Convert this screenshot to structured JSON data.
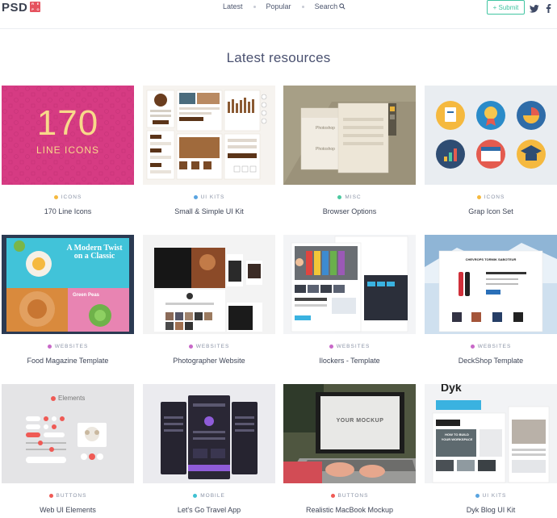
{
  "header": {
    "logo_text": "PSD",
    "logo_badge": [
      "R",
      "E",
      "P",
      "O"
    ],
    "nav": [
      {
        "label": "Latest"
      },
      {
        "label": "Popular"
      },
      {
        "label": "Search"
      }
    ],
    "submit_label": "+ Submit",
    "social_icons": [
      "twitter-icon",
      "facebook-icon"
    ]
  },
  "section_title": "Latest resources",
  "category_colors": {
    "ICONS": "#f5b93f",
    "UI KITS": "#5aa4e0",
    "MISC": "#4cc9a0",
    "WEBSITES": "#c868c8",
    "BUTTONS": "#ef5a55",
    "MOBILE": "#3fc1d2"
  },
  "cards": [
    {
      "category": "ICONS",
      "title": "170 Line Icons",
      "thumb_text": [
        "170",
        "LINE ICONS"
      ]
    },
    {
      "category": "UI KITS",
      "title": "Small & Simple UI Kit"
    },
    {
      "category": "MISC",
      "title": "Browser Options",
      "thumb_text": [
        "Photoshop",
        "Photoshop"
      ]
    },
    {
      "category": "ICONS",
      "title": "Grap Icon Set"
    },
    {
      "category": "WEBSITES",
      "title": "Food Magazine Template",
      "thumb_text": [
        "A Modern Twist",
        "on a Classic",
        "Green Peas"
      ]
    },
    {
      "category": "WEBSITES",
      "title": "Photographer Website"
    },
    {
      "category": "WEBSITES",
      "title": "Ilockers - Template"
    },
    {
      "category": "WEBSITES",
      "title": "DeckShop Template",
      "thumb_text": [
        "CHEVROPS TORMIK SABOTEUR"
      ]
    },
    {
      "category": "BUTTONS",
      "title": "Web UI Elements",
      "thumb_text": [
        "Elements"
      ]
    },
    {
      "category": "MOBILE",
      "title": "Let's Go Travel App"
    },
    {
      "category": "BUTTONS",
      "title": "Realistic MacBook Mockup",
      "thumb_text": [
        "YOUR MOCKUP"
      ]
    },
    {
      "category": "UI KITS",
      "title": "Dyk Blog UI Kit",
      "thumb_text": [
        "Dyk",
        "HOW TO BUILD",
        "YOUR WORKSPACE"
      ]
    }
  ]
}
